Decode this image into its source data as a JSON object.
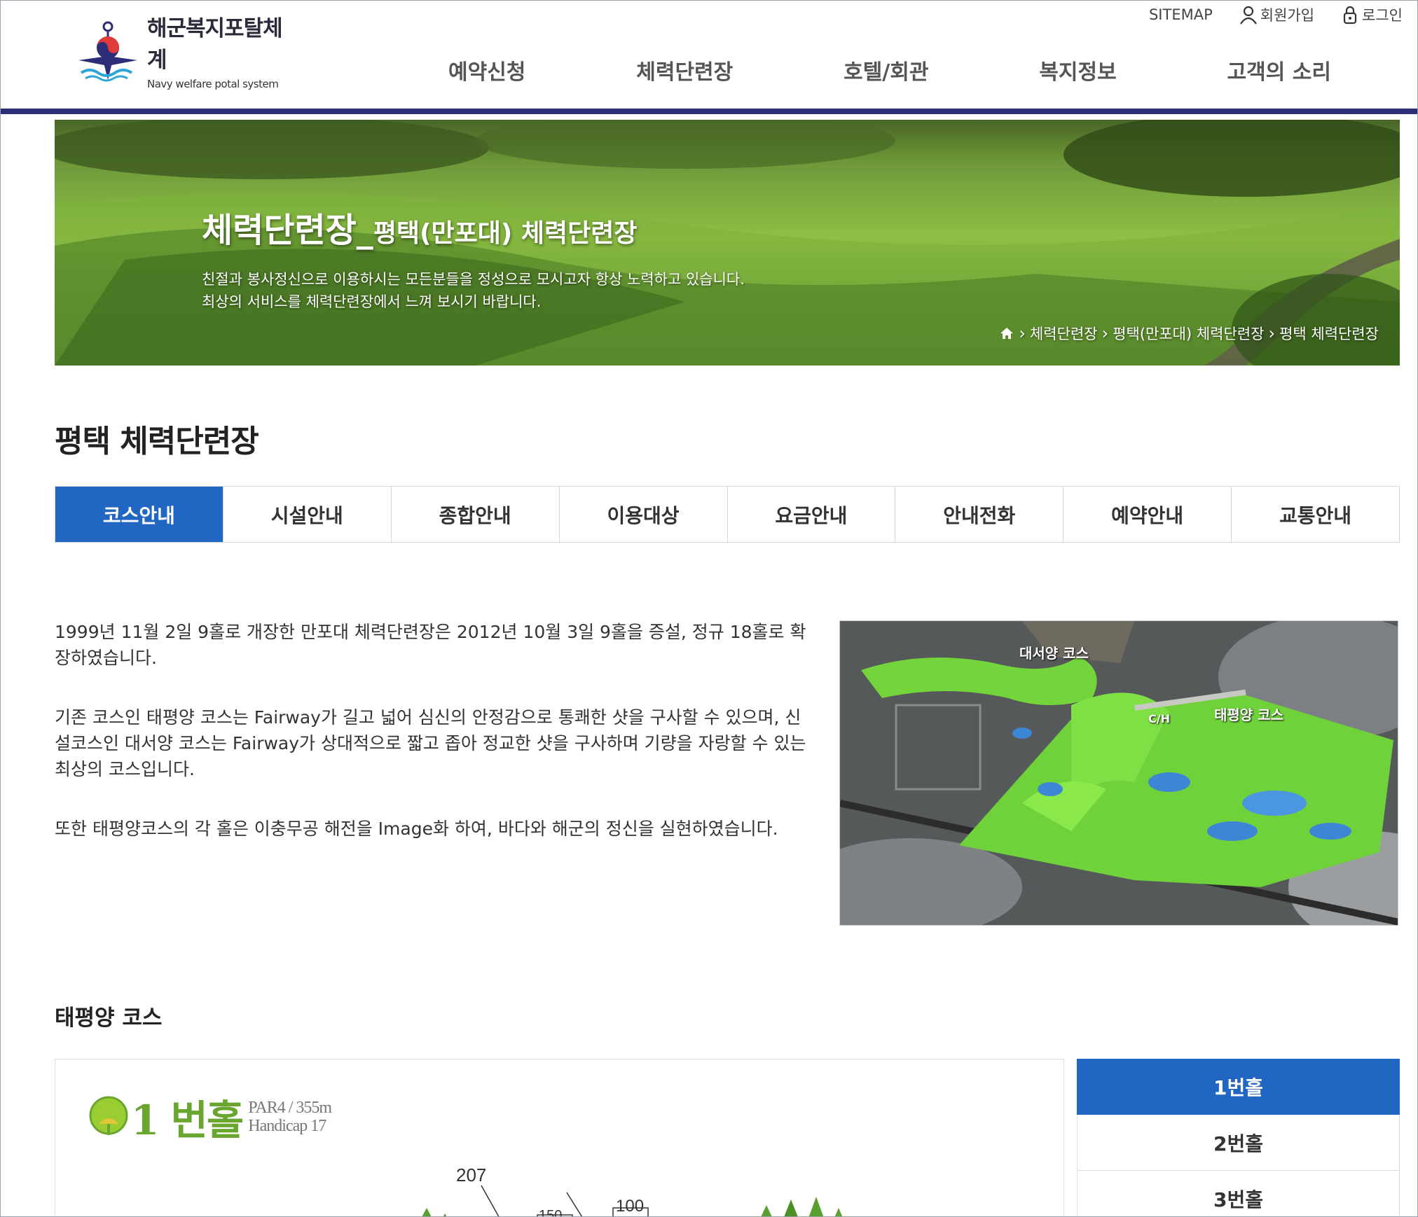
{
  "header": {
    "logo_kr": "해군복지포탈체계",
    "logo_en": "Navy welfare potal system",
    "util": {
      "sitemap": "SITEMAP",
      "join": "회원가입",
      "login": "로그인"
    },
    "gnb": [
      "예약신청",
      "체력단련장",
      "호텔/회관",
      "복지정보",
      "고객의 소리"
    ]
  },
  "banner": {
    "title_main": "체력단련장_",
    "title_sub": "평택(만포대) 체력단련장",
    "desc_line1": "친절과 봉사정신으로 이용하시는 모든분들을 정성으로 모시고자 항상 노력하고 있습니다.",
    "desc_line2": "최상의 서비스를 체력단련장에서 느껴 보시기 바랍니다.",
    "breadcrumb": [
      "체력단련장",
      "평택(만포대) 체력단련장",
      "평택 체력단련장"
    ]
  },
  "page": {
    "title": "평택 체력단련장"
  },
  "tabs": [
    "코스안내",
    "시설안내",
    "종합안내",
    "이용대상",
    "요금안내",
    "안내전화",
    "예약안내",
    "교통안내"
  ],
  "intro": {
    "p1": "1999년 11월 2일 9홀로 개장한 만포대 체력단련장은 2012년 10월 3일 9홀을 증설, 정규 18홀로 확장하였습니다.",
    "p2": "기존 코스인 태평양 코스는 Fairway가 길고 넓어 심신의 안정감으로 통쾌한 샷을 구사할 수 있으며, 신설코스인 대서양 코스는 Fairway가 상대적으로 짧고 좁아 정교한 샷을 구사하며 기량을 자랑할 수 있는 최상의 코스입니다.",
    "p3": "또한 태평양코스의 각 홀은 이충무공 해전을 Image화 하여, 바다와 해군의 정신을 실현하였습니다."
  },
  "course_map": {
    "label_atlantic": "대서양 코스",
    "label_pacific": "태평양 코스",
    "label_ch": "C/H"
  },
  "section": {
    "heading": "태평양 코스"
  },
  "hole": {
    "name": "1 번홀",
    "par": "PAR4 / 355m",
    "handicap": "Handicap 17",
    "marker_207": "207",
    "marker_150": "150",
    "marker_100": "100"
  },
  "hole_list": [
    "1번홀",
    "2번홀",
    "3번홀"
  ],
  "colors": {
    "accent_blue": "#2266c4",
    "header_bar": "#2c2f78",
    "hole_green": "#6aa530"
  }
}
